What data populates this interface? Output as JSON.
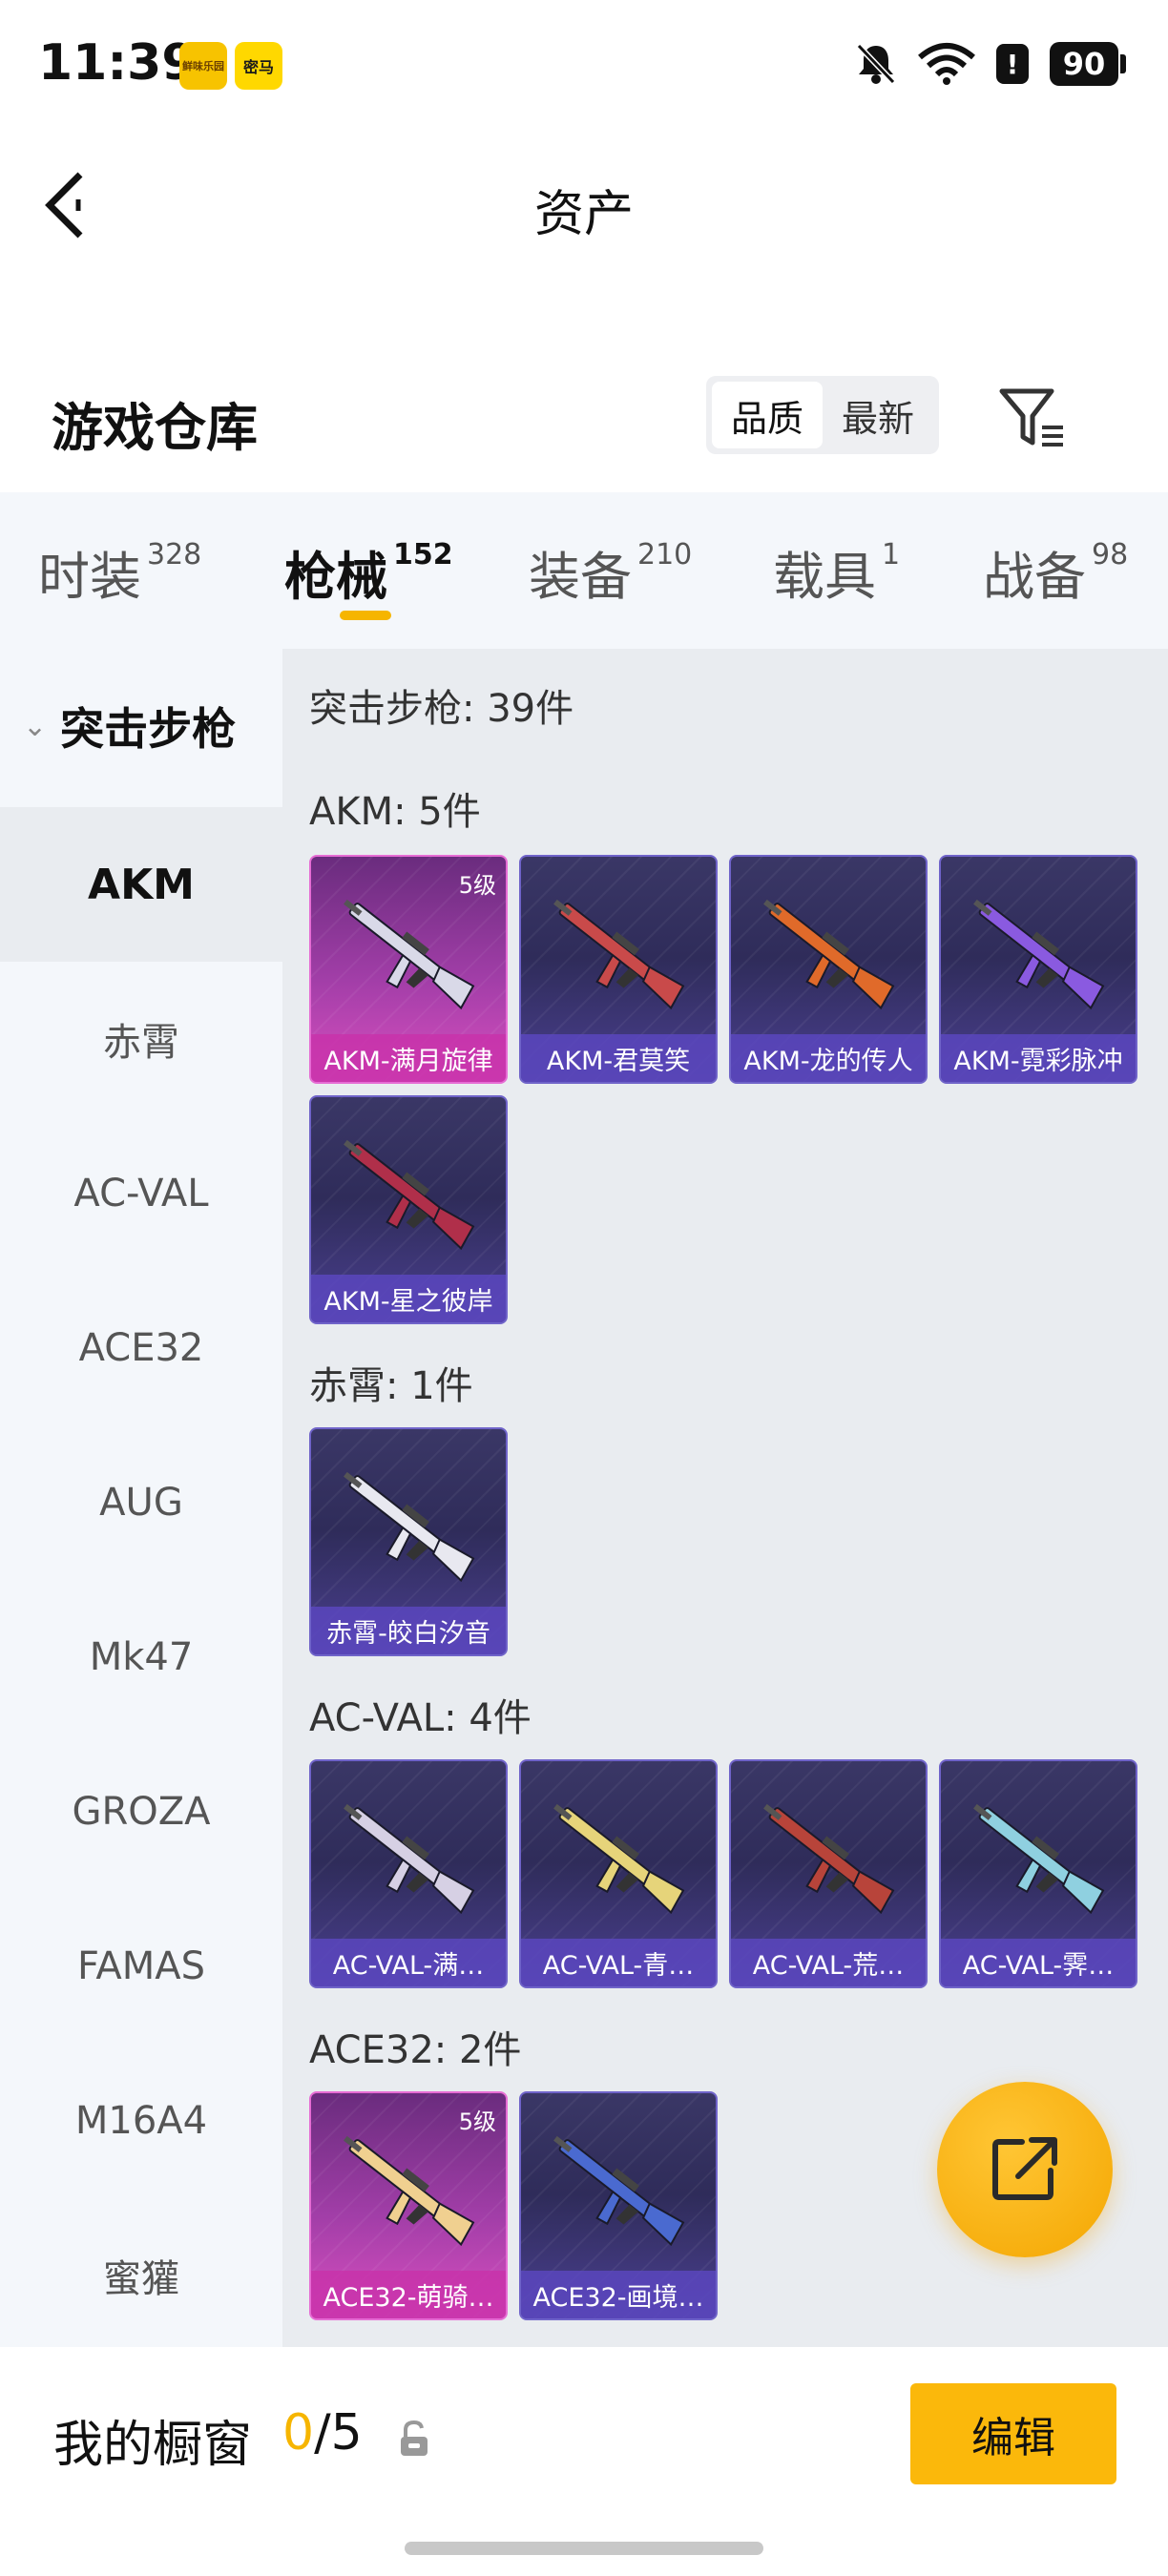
{
  "status_bar": {
    "time": "11:39",
    "app_badges": [
      "鲜味乐园",
      "密马"
    ],
    "battery": "90",
    "icons": [
      "bell-mute-icon",
      "wifi-icon",
      "alert-icon",
      "battery-icon"
    ]
  },
  "header": {
    "title": "资产"
  },
  "warehouse": {
    "title": "游戏仓库",
    "sort": [
      "品质",
      "最新"
    ],
    "sort_selected": "品质"
  },
  "tabs": [
    {
      "label": "时装",
      "count": "328"
    },
    {
      "label": "枪械",
      "count": "152"
    },
    {
      "label": "装备",
      "count": "210"
    },
    {
      "label": "载具",
      "count": "1"
    },
    {
      "label": "战备",
      "count": "98"
    }
  ],
  "sidebar": {
    "group": "突击步枪",
    "items": [
      "AKM",
      "赤霄",
      "AC-VAL",
      "ACE32",
      "AUG",
      "Mk47",
      "GROZA",
      "FAMAS",
      "M16A4",
      "蜜獾"
    ]
  },
  "content": {
    "summary": "突击步枪: 39件",
    "sections": [
      {
        "title": "AKM: 5件",
        "items": [
          {
            "name": "AKM-满月旋律",
            "level": "5级",
            "rarity": "gold",
            "color": "#d9d9e8"
          },
          {
            "name": "AKM-君莫笑",
            "rarity": "purple",
            "color": "#c94a4a"
          },
          {
            "name": "AKM-龙的传人",
            "rarity": "purple",
            "color": "#e06a2a"
          },
          {
            "name": "AKM-霓彩脉冲",
            "rarity": "purple",
            "color": "#8a5ae0"
          },
          {
            "name": "AKM-星之彼岸",
            "rarity": "purple",
            "color": "#b02f4a"
          }
        ]
      },
      {
        "title": "赤霄: 1件",
        "items": [
          {
            "name": "赤霄-皎白汐音",
            "rarity": "purple",
            "color": "#e8e8f0"
          }
        ]
      },
      {
        "title": "AC-VAL: 4件",
        "items": [
          {
            "name": "AC-VAL-满…",
            "rarity": "purple",
            "color": "#d6d0e4"
          },
          {
            "name": "AC-VAL-青…",
            "rarity": "purple",
            "color": "#e6d47a"
          },
          {
            "name": "AC-VAL-荒…",
            "rarity": "purple",
            "color": "#b8443a"
          },
          {
            "name": "AC-VAL-霁…",
            "rarity": "purple",
            "color": "#8fd0e0"
          }
        ]
      },
      {
        "title": "ACE32: 2件",
        "items": [
          {
            "name": "ACE32-萌骑…",
            "level": "5级",
            "rarity": "gold",
            "color": "#f0d090"
          },
          {
            "name": "ACE32-画境…",
            "rarity": "purple",
            "color": "#4a6ad0"
          }
        ]
      }
    ]
  },
  "bottom": {
    "showcase_label": "我的橱窗",
    "showcase_current": "0",
    "showcase_total": "/5",
    "edit_label": "编辑"
  },
  "colors": {
    "accent": "#f6b500",
    "tab_bg": "#f4f7fb",
    "content_bg": "#e9ecf0"
  }
}
